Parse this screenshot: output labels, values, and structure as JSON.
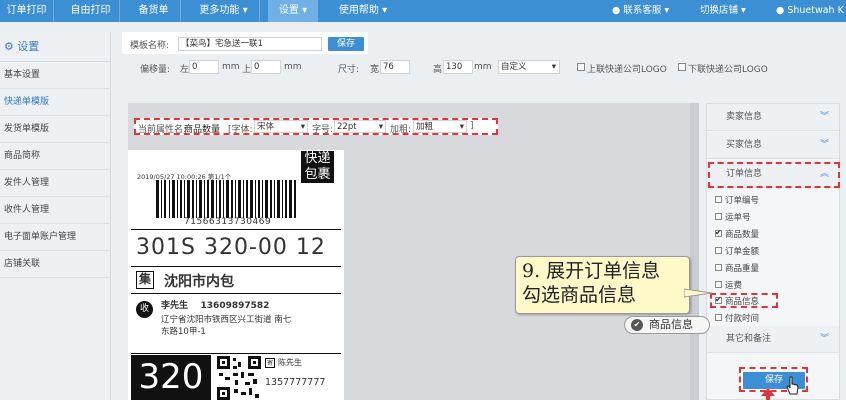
{
  "topnav": {
    "items": [
      "订单打印",
      "自由打印",
      "备货单",
      "更多功能",
      "设置",
      "使用帮助"
    ],
    "right_items": [
      "联系客服",
      "切换店铺",
      "Shuetwah K"
    ]
  },
  "sidebar": {
    "title": "设置",
    "items": [
      "基本设置",
      "快递单模版",
      "发货单模版",
      "商品简称",
      "发件人管理",
      "收件人管理",
      "电子面单账户管理",
      "店铺关联"
    ]
  },
  "template": {
    "name_label": "模板名称:",
    "name_value": "【菜鸟】宅急送一联1",
    "save_label": "保存"
  },
  "offset": {
    "label": "偏移量:",
    "left_label": "左",
    "left_value": "0",
    "unit1": "mm",
    "up_label": "上",
    "up_value": "0",
    "unit2": "mm"
  },
  "size": {
    "label": "尺寸:",
    "width_label": "宽",
    "width_value": "76",
    "height_label": "高",
    "height_value": "130",
    "unit": "mm",
    "mode": "自定义",
    "logo_upper": "上联快递公司LOGO",
    "logo_lower": "下联快递公司LOGO"
  },
  "propbar": {
    "current_label": "当前属性名:",
    "current_value": "商品数量",
    "font_label": "[字体:",
    "font_value": "宋体",
    "size_label": "字号:",
    "size_value": "22pt",
    "bold_label": "加粗:",
    "bold_value": "加粗",
    "end": "]"
  },
  "label": {
    "datetime": "2019/05/27  10:00:26  第1/1个",
    "badge_line1": "快递",
    "badge_line2": "包裹",
    "tracking": "71566313730469",
    "sort_code": "301S 320-00 12",
    "ji": "集",
    "distribution": "沈阳市内包",
    "shou": "收",
    "recipient": "李先生    13609897582",
    "address1": "辽宁省沈阳市铁西区兴工街道 南七",
    "address2": "东路10甲-1",
    "big_code": "320",
    "sender_icon": "寄",
    "sender": "陈先生",
    "sender_phone": "1357777777"
  },
  "right_panel": {
    "sections": [
      "卖家信息",
      "买家信息",
      "订单信息",
      "其它和备注"
    ],
    "items": [
      {
        "label": "订单编号",
        "checked": false
      },
      {
        "label": "运单号",
        "checked": false
      },
      {
        "label": "商品数量",
        "checked": true
      },
      {
        "label": "订单金额",
        "checked": false
      },
      {
        "label": "商品重量",
        "checked": false
      },
      {
        "label": "运费",
        "checked": false
      },
      {
        "label": "商品信息",
        "checked": true
      },
      {
        "label": "付款时间",
        "checked": false
      }
    ],
    "save_label": "保存"
  },
  "callout": {
    "text": "9. 展开订单信息\n勾选商品信息",
    "pill": "商品信息"
  },
  "colors": {
    "nav": "#3d8fd3",
    "highlight": "#e0343a",
    "callout": "#fff8c8"
  }
}
